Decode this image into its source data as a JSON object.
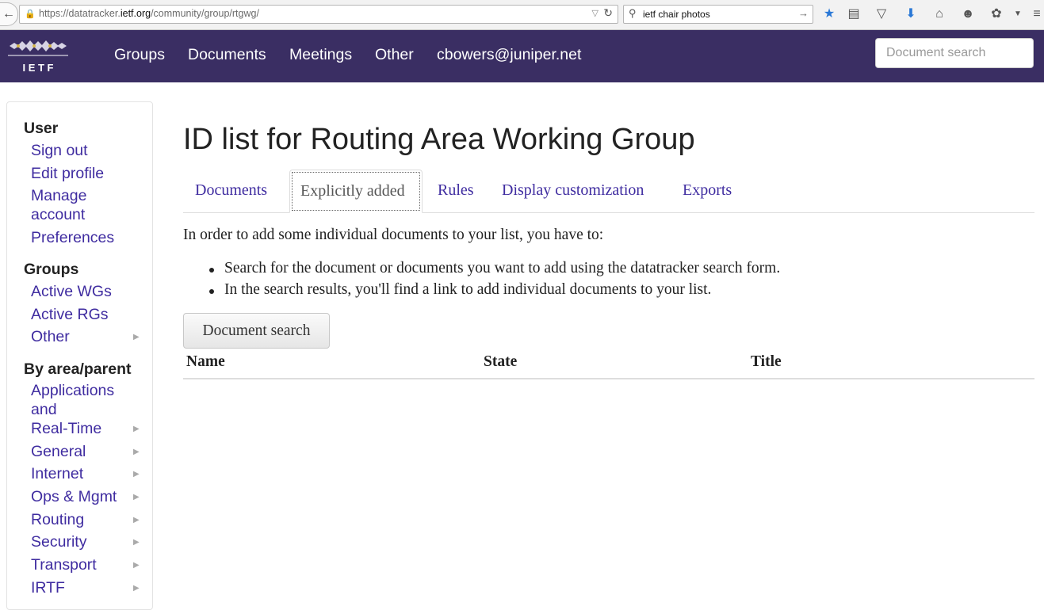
{
  "browser": {
    "url_prefix": "https://datatracker.",
    "url_host": "ietf.org",
    "url_suffix": "/community/group/rtgwg/",
    "search_text": "ietf chair photos",
    "back_icon": "back-arrow-icon",
    "lock_icon": "lock-icon"
  },
  "navbar": {
    "logo_text": "I E T F",
    "links": [
      "Groups",
      "Documents",
      "Meetings",
      "Other",
      "cbowers@juniper.net"
    ],
    "search_placeholder": "Document search"
  },
  "sidebar": {
    "user_heading": "User",
    "user_links": [
      "Sign out",
      "Edit profile",
      "Manage",
      "account",
      "Preferences"
    ],
    "groups_heading": "Groups",
    "group_links": [
      "Active WGs",
      "Active RGs",
      "Other"
    ],
    "area_heading": "By area/parent",
    "area_links": [
      "Applications",
      "and",
      "Real-Time",
      "General",
      "Internet",
      "Ops & Mgmt",
      "Routing",
      "Security",
      "Transport",
      "IRTF"
    ]
  },
  "main": {
    "title": "ID list for Routing Area Working Group",
    "tabs": [
      "Documents",
      "Explicitly added",
      "Rules",
      "Display customization",
      "Exports"
    ],
    "active_tab": "Explicitly added",
    "intro": "In order to add some individual documents to your list, you have to:",
    "bullets": [
      "Search for the document or documents you want to add using the datatracker search form.",
      "In the search results, you'll find a link to add individual documents to your list."
    ],
    "button_label": "Document search",
    "table_headers": [
      "Name",
      "State",
      "Title"
    ]
  },
  "colors": {
    "navbar_bg": "#3a2e63",
    "link": "#3f2ca0"
  }
}
